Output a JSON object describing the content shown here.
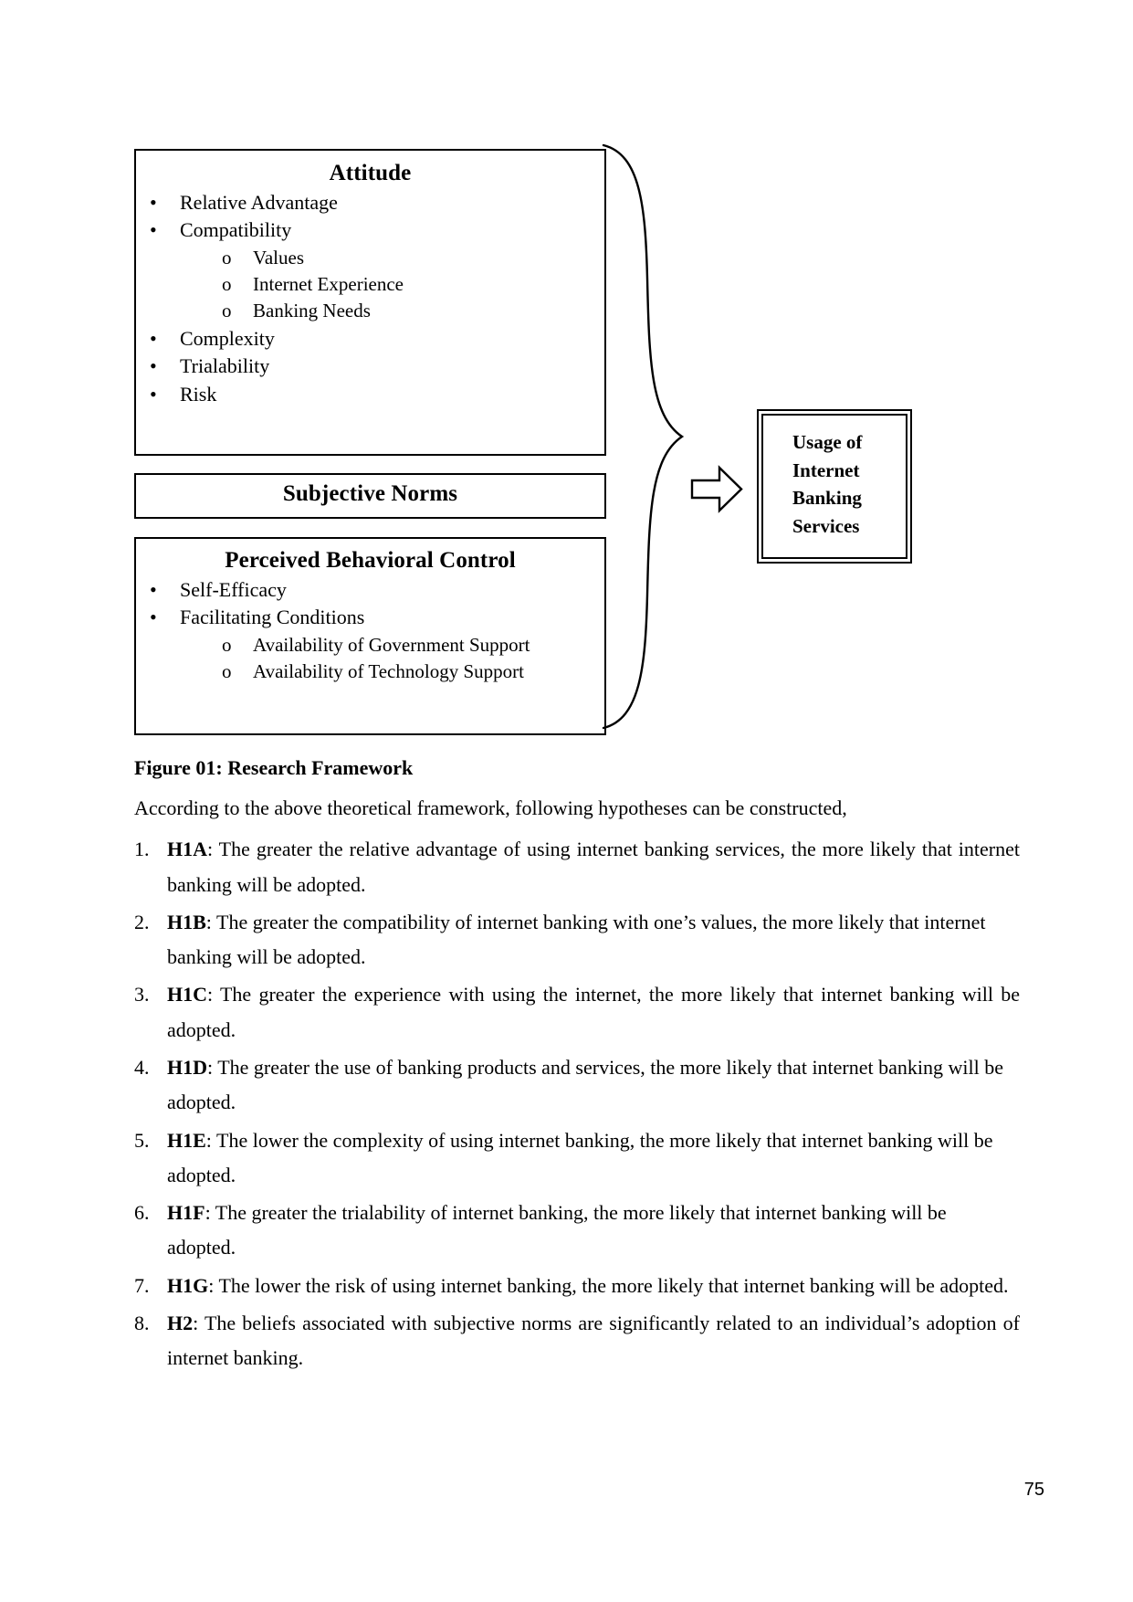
{
  "figure": {
    "attitude_box": {
      "title": "Attitude",
      "items": [
        {
          "label": "Relative Advantage",
          "subitems": []
        },
        {
          "label": "Compatibility",
          "subitems": [
            "Values",
            "Internet Experience",
            "Banking Needs"
          ]
        },
        {
          "label": "Complexity",
          "subitems": []
        },
        {
          "label": "Trialability",
          "subitems": []
        },
        {
          "label": "Risk",
          "subitems": []
        }
      ]
    },
    "norms_box": {
      "title": "Subjective Norms"
    },
    "pbc_box": {
      "title": "Perceived Behavioral Control",
      "items": [
        {
          "label": "Self-Efficacy",
          "subitems": []
        },
        {
          "label": "Facilitating Conditions",
          "subitems": [
            "Availability of Government Support",
            "Availability of Technology Support"
          ]
        }
      ]
    },
    "usage_box": {
      "lines": [
        "Usage of",
        "Internet",
        "Banking",
        "Services"
      ]
    },
    "bullet_glyph": "•",
    "subbullet_glyph": "o",
    "arrow_icon": "right-block-arrow",
    "brace_icon": "right-curly-brace"
  },
  "body": {
    "caption": "Figure 01: Research Framework",
    "intro": "According to the above theoretical framework, following hypotheses can be constructed,",
    "hypotheses": [
      {
        "tag": "H1A",
        "text": ": The greater the relative advantage of using internet banking services, the more likely that internet banking will be adopted.",
        "justify": true
      },
      {
        "tag": "H1B",
        "text": ": The greater the compatibility of internet banking with one’s values, the more likely that internet banking will be adopted.",
        "justify": false
      },
      {
        "tag": "H1C",
        "text": ": The greater the experience with using the internet, the more likely that internet banking will be adopted.",
        "justify": true
      },
      {
        "tag": "H1D",
        "text": ": The greater the use of banking products and services, the more likely that internet banking will be adopted.",
        "justify": false
      },
      {
        "tag": "H1E",
        "text": ": The lower the complexity of using internet banking, the more likely that internet banking will be adopted.",
        "justify": false
      },
      {
        "tag": "H1F",
        "text": ": The greater the trialability of internet banking, the more likely that internet banking will be adopted.",
        "justify": false
      },
      {
        "tag": "H1G",
        "text": ": The lower the risk of using internet banking, the more likely that internet banking will be adopted.",
        "justify": false
      },
      {
        "tag": "H2",
        "text": ": The beliefs associated with subjective norms are significantly related to an individual’s adoption of internet banking.",
        "justify": true
      }
    ]
  },
  "footer": {
    "page_number": "75"
  },
  "colors": {
    "ink": "#000000",
    "paper": "#ffffff"
  }
}
